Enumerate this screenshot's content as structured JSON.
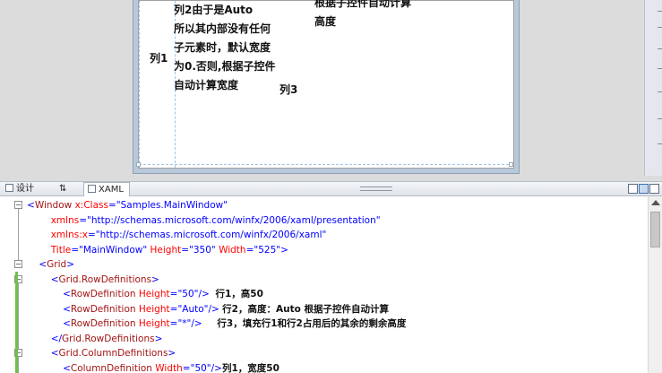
{
  "design": {
    "col1_label": "列1",
    "col2_text": "列2由于是Auto\n所以其内部没有任何\n子元素时，默认宽度\n为0.否则,根据子控件\n自动计算宽度",
    "col3_label": "列3",
    "row2_text": "根据子控件自动计算\n高度"
  },
  "tabs": {
    "design": "设计",
    "swap": "⇅",
    "xaml": "XAML"
  },
  "code": {
    "l1_tag": "Window",
    "l1_attr": "x:Class",
    "l1_val": "\"Samples.MainWindow\"",
    "l2_attr": "xmlns",
    "l2_val": "\"http://schemas.microsoft.com/winfx/2006/xaml/presentation\"",
    "l3_attr": "xmlns:x",
    "l3_val": "\"http://schemas.microsoft.com/winfx/2006/xaml\"",
    "l4_a1": "Title",
    "l4_v1": "\"MainWindow\"",
    "l4_a2": "Height",
    "l4_v2": "\"350\"",
    "l4_a3": "Width",
    "l4_v3": "\"525\"",
    "l5_tag": "Grid",
    "l6_tag": "Grid.RowDefinitions",
    "l7_tag": "RowDefinition",
    "l7_attr": "Height",
    "l7_val": "\"50\"",
    "l7_comment": "行1，高50",
    "l8_tag": "RowDefinition",
    "l8_attr": "Height",
    "l8_val": "\"Auto\"",
    "l8_comment": "行2，高度：Auto 根据子控件自动计算",
    "l9_tag": "RowDefinition",
    "l9_attr": "Height",
    "l9_val": "\"*\"",
    "l9_comment": "行3，填充行1和行2占用后的其余的剩余高度",
    "l10_tag": "Grid.RowDefinitions",
    "l11_tag": "Grid.ColumnDefinitions",
    "l12_tag": "ColumnDefinition",
    "l12_attr": "Width",
    "l12_val": "\"50\"",
    "l12_comment": "列1，宽度50"
  }
}
